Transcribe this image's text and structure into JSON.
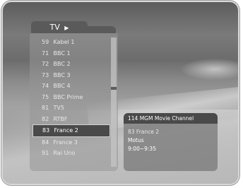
{
  "list": {
    "title": "TV",
    "arrow": "▶",
    "channels": [
      {
        "num": "59",
        "name": "Kabel 1"
      },
      {
        "num": "71",
        "name": "BBC 1"
      },
      {
        "num": "72",
        "name": "BBC 2"
      },
      {
        "num": "73",
        "name": "BBC 3"
      },
      {
        "num": "74",
        "name": "BBC 4"
      },
      {
        "num": "75",
        "name": "BBC Prime"
      },
      {
        "num": "81",
        "name": "TV5"
      },
      {
        "num": "82",
        "name": "RTBF"
      },
      {
        "num": "83",
        "name": "France 2"
      },
      {
        "num": "84",
        "name": "France 3"
      },
      {
        "num": "91",
        "name": "Rai Uno"
      }
    ],
    "selected_index": 8
  },
  "info": {
    "title": "114  MGM Movie Channel",
    "channel": "83  France 2",
    "program": "Motus",
    "time": "9:00~9:35"
  }
}
